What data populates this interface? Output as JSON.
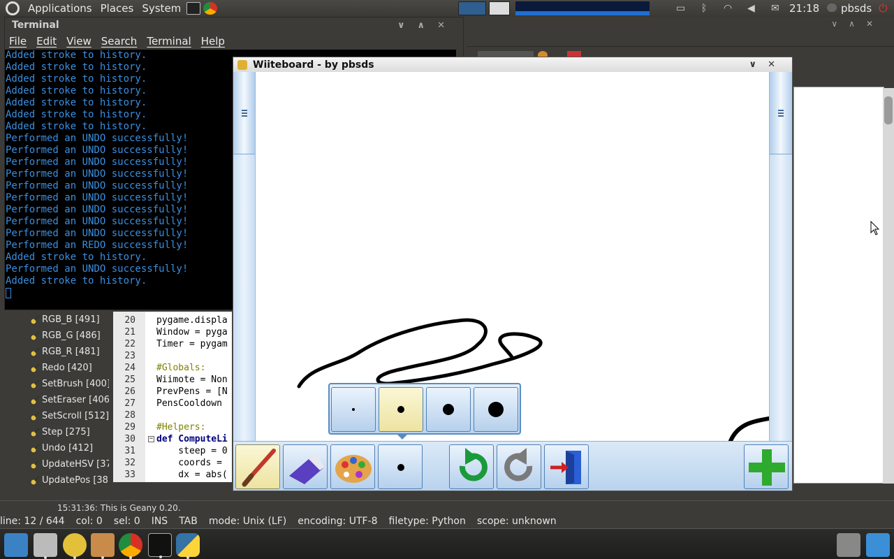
{
  "top_panel": {
    "menus": [
      "Applications",
      "Places",
      "System"
    ],
    "clock": "21:18",
    "user": "pbsds"
  },
  "terminal": {
    "title": "Terminal",
    "menu": [
      "File",
      "Edit",
      "View",
      "Search",
      "Terminal",
      "Help"
    ],
    "lines": [
      "Added stroke to history.",
      "Added stroke to history.",
      "Added stroke to history.",
      "Added stroke to history.",
      "Added stroke to history.",
      "Added stroke to history.",
      "Added stroke to history.",
      "Performed an UNDO successfully!",
      "Performed an UNDO successfully!",
      "Performed an UNDO successfully!",
      "Performed an UNDO successfully!",
      "Performed an UNDO successfully!",
      "Performed an UNDO successfully!",
      "Performed an UNDO successfully!",
      "Performed an UNDO successfully!",
      "Performed an UNDO successfully!",
      "Performed an REDO successfully!",
      "Added stroke to history.",
      "Performed an UNDO successfully!",
      "Added stroke to history."
    ]
  },
  "whiteboard": {
    "title": "Wiiteboard - by pbsds",
    "brush_sizes": [
      "small",
      "medium",
      "large",
      "extra-large"
    ],
    "selected_size": "medium"
  },
  "geany": {
    "symbols": [
      "RGB_B [491]",
      "RGB_G [486]",
      "RGB_R [481]",
      "Redo [420]",
      "SetBrush [400]",
      "SetEraser [406",
      "SetScroll [512]",
      "Step [275]",
      "Undo [412]",
      "UpdateHSV [37",
      "UpdatePos [38"
    ],
    "code_lines": [
      {
        "n": "20",
        "t": "pygame.displa"
      },
      {
        "n": "21",
        "t": "Window = pyga"
      },
      {
        "n": "22",
        "t": "Timer = pygam"
      },
      {
        "n": "23",
        "t": ""
      },
      {
        "n": "24",
        "t": "#Globals:"
      },
      {
        "n": "25",
        "t": "Wiimote = Non"
      },
      {
        "n": "26",
        "t": "PrevPens = [N"
      },
      {
        "n": "27",
        "t": "PensCooldown "
      },
      {
        "n": "28",
        "t": ""
      },
      {
        "n": "29",
        "t": "#Helpers:"
      },
      {
        "n": "30",
        "t": "def ComputeLi"
      },
      {
        "n": "31",
        "t": "    steep = 0"
      },
      {
        "n": "32",
        "t": "    coords = "
      },
      {
        "n": "33",
        "t": "    dx = abs("
      }
    ],
    "message": "15:31:36: This is Geany 0.20.",
    "status": {
      "line": "line: 12 / 644",
      "col": "col: 0",
      "sel": "sel: 0",
      "ins": "INS",
      "tab": "TAB",
      "mode": "mode: Unix (LF)",
      "encoding": "encoding: UTF-8",
      "filetype": "filetype: Python",
      "scope": "scope: unknown"
    }
  }
}
